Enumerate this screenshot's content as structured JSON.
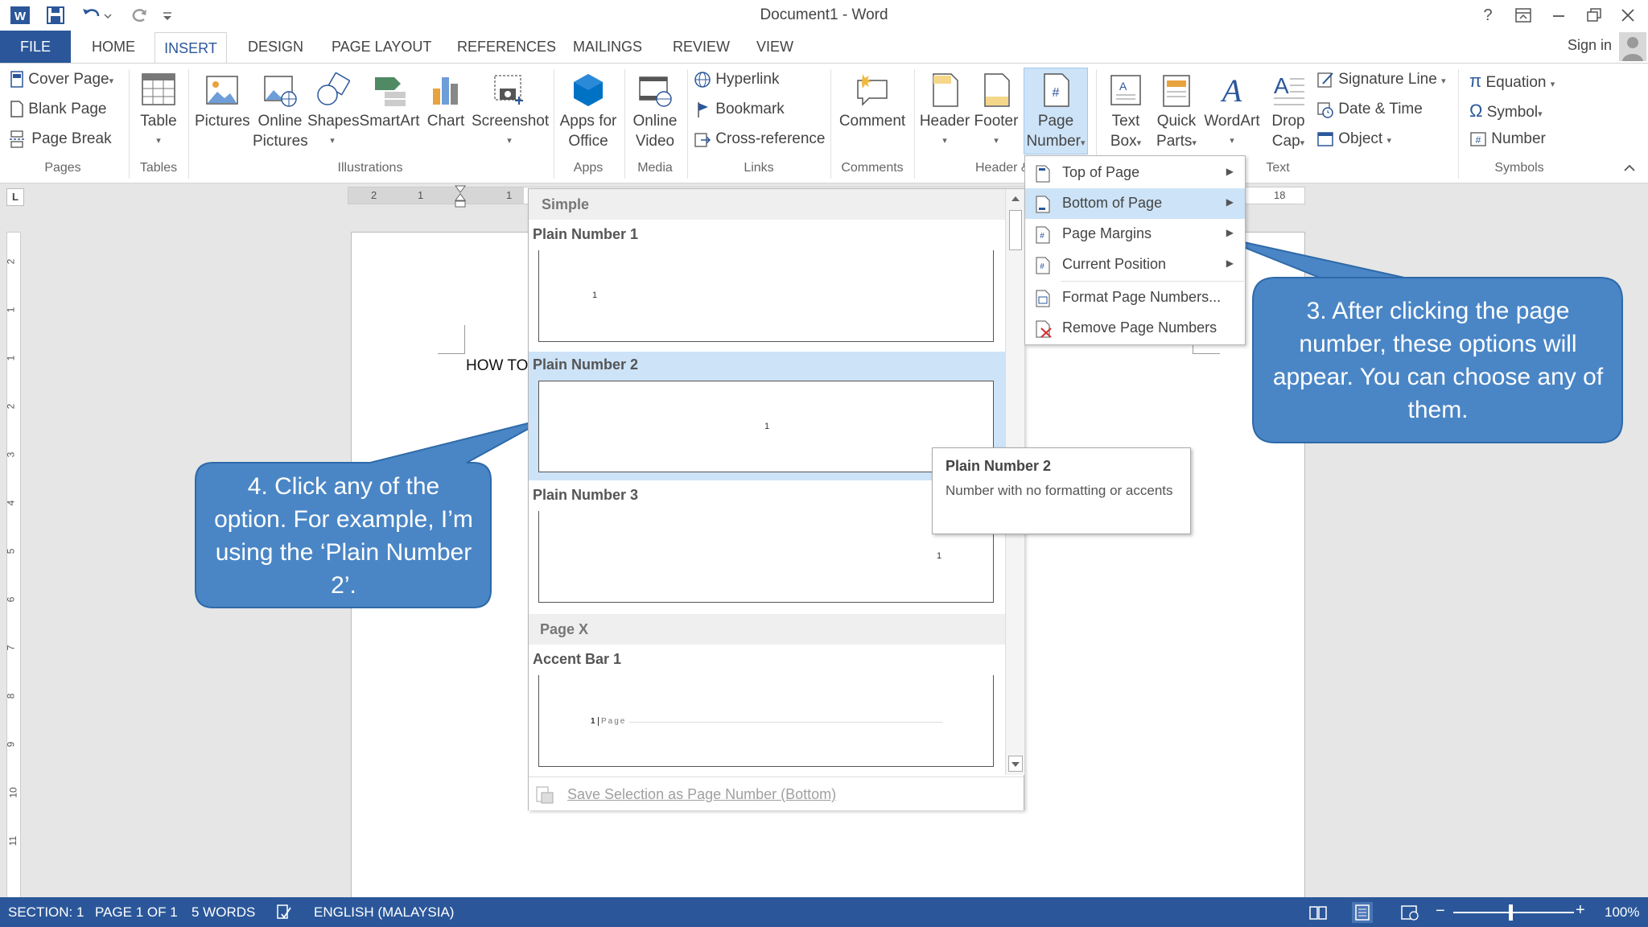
{
  "window": {
    "title": "Document1 - Word",
    "sign_in": "Sign in",
    "help": "?"
  },
  "tabs": [
    "FILE",
    "HOME",
    "INSERT",
    "DESIGN",
    "PAGE LAYOUT",
    "REFERENCES",
    "MAILINGS",
    "REVIEW",
    "VIEW"
  ],
  "ribbon": {
    "pages": {
      "items": [
        "Cover Page",
        "Blank Page",
        "Page Break"
      ],
      "group": "Pages"
    },
    "tables": {
      "label": "Table",
      "group": "Tables"
    },
    "illustrations": {
      "pictures": "Pictures",
      "online_pictures_1": "Online",
      "online_pictures_2": "Pictures",
      "shapes": "Shapes",
      "smartart": "SmartArt",
      "chart": "Chart",
      "screenshot": "Screenshot",
      "group": "Illustrations"
    },
    "apps": {
      "label_1": "Apps for",
      "label_2": "Office",
      "group": "Apps"
    },
    "media": {
      "label_1": "Online",
      "label_2": "Video",
      "group": "Media"
    },
    "links": {
      "items": [
        "Hyperlink",
        "Bookmark",
        "Cross-reference"
      ],
      "group": "Links"
    },
    "comments": {
      "label": "Comment",
      "group": "Comments"
    },
    "header_footer": {
      "header": "Header",
      "footer": "Footer",
      "page_number_1": "Page",
      "page_number_2": "Number",
      "group": "Header & F"
    },
    "text": {
      "textbox_1": "Text",
      "textbox_2": "Box",
      "quickparts_1": "Quick",
      "quickparts_2": "Parts",
      "wordart": "WordArt",
      "dropcap_1": "Drop",
      "dropcap_2": "Cap",
      "items": [
        "Signature Line",
        "Date & Time",
        "Object"
      ],
      "group": "Text"
    },
    "symbols": {
      "items": [
        "Equation",
        "Symbol",
        "Number"
      ],
      "group": "Symbols"
    }
  },
  "ruler": {
    "left_labels": [
      "2",
      "1",
      "1"
    ],
    "right_label": "18",
    "vertical_labels": [
      "2",
      "1",
      "1",
      "2",
      "3",
      "4",
      "5",
      "6",
      "7",
      "8",
      "9",
      "10",
      "11"
    ]
  },
  "document": {
    "text": "HOW TO"
  },
  "gallery": {
    "section_simple": "Simple",
    "items": [
      {
        "title": "Plain Number 1",
        "sample": "1"
      },
      {
        "title": "Plain Number 2",
        "sample": "1"
      },
      {
        "title": "Plain Number 3",
        "sample": "1"
      }
    ],
    "section_pagex": "Page X",
    "accent": {
      "title": "Accent Bar 1",
      "sample_num": "1",
      "sample_text": "Page"
    },
    "footer_action": "Save Selection as Page Number (Bottom)"
  },
  "menu": {
    "items": [
      {
        "label": "Top of Page",
        "submenu": true
      },
      {
        "label": "Bottom of Page",
        "submenu": true
      },
      {
        "label": "Page Margins",
        "submenu": true
      },
      {
        "label": "Current Position",
        "submenu": true
      },
      {
        "label": "Format Page Numbers...",
        "submenu": false
      },
      {
        "label": "Remove Page Numbers",
        "submenu": false
      }
    ]
  },
  "tooltip": {
    "title": "Plain Number 2",
    "description": "Number with no formatting or accents"
  },
  "callouts": {
    "step3": "3. After clicking the page number, these options will appear. You can choose any of them.",
    "step4": "4. Click any of the option. For example, I’m using the ‘Plain Number 2’."
  },
  "statusbar": {
    "section": "SECTION: 1",
    "page": "PAGE 1 OF 1",
    "words": "5 WORDS",
    "language": "ENGLISH (MALAYSIA)",
    "zoom": "100%"
  },
  "colors": {
    "accent": "#2b579a",
    "callout": "#3f7ec4",
    "selected": "#cde3f7"
  }
}
